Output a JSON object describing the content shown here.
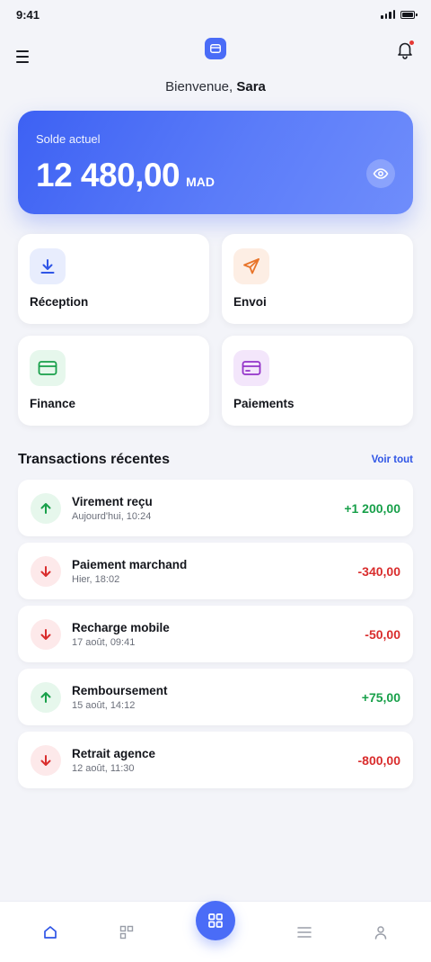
{
  "status": {
    "time": "9:41"
  },
  "header": {
    "menu_icon": "hamburger-icon",
    "logo_icon": "card-icon",
    "bell_icon": "bell-icon",
    "notification_dot_color": "#e53935"
  },
  "greeting": {
    "prefix": "Bienvenue, ",
    "name": "Sara"
  },
  "balance": {
    "label": "Solde actuel",
    "amount": "12 480,00",
    "currency": "MAD",
    "toggle_icon": "eye-icon"
  },
  "actions": [
    {
      "label": "Réception",
      "icon": "download-icon",
      "color": "#2f55e6",
      "bg": "#e8edfd"
    },
    {
      "label": "Envoi",
      "icon": "send-icon",
      "color": "#e8742a",
      "bg": "#fdeee4"
    },
    {
      "label": "Finance",
      "icon": "card-icon",
      "color": "#18a04a",
      "bg": "#e6f7ec"
    },
    {
      "label": "Paiements",
      "icon": "wallet-icon",
      "color": "#9333c9",
      "bg": "#f3e6fb"
    }
  ],
  "transactions_section": {
    "title": "Transactions récentes",
    "see_all": "Voir tout"
  },
  "transactions": [
    {
      "title": "Virement reçu",
      "date": "Aujourd'hui, 10:24",
      "amount": "+1 200,00",
      "direction": "in"
    },
    {
      "title": "Paiement marchand",
      "date": "Hier, 18:02",
      "amount": "-340,00",
      "direction": "out"
    },
    {
      "title": "Recharge mobile",
      "date": "17 août, 09:41",
      "amount": "-50,00",
      "direction": "out"
    },
    {
      "title": "Remboursement",
      "date": "15 août, 14:12",
      "amount": "+75,00",
      "direction": "in"
    },
    {
      "title": "Retrait agence",
      "date": "12 août, 11:30",
      "amount": "-800,00",
      "direction": "out"
    }
  ],
  "bottom_nav": [
    {
      "icon": "home-icon",
      "active": true
    },
    {
      "icon": "grid-icon",
      "active": false
    },
    {
      "icon": "scan-icon",
      "active": false,
      "center": true
    },
    {
      "icon": "list-icon",
      "active": false
    },
    {
      "icon": "user-icon",
      "active": false
    }
  ],
  "colors": {
    "accent": "#4a6cf7",
    "positive": "#18a04a",
    "negative": "#d92d2d",
    "background": "#f3f4f9"
  }
}
